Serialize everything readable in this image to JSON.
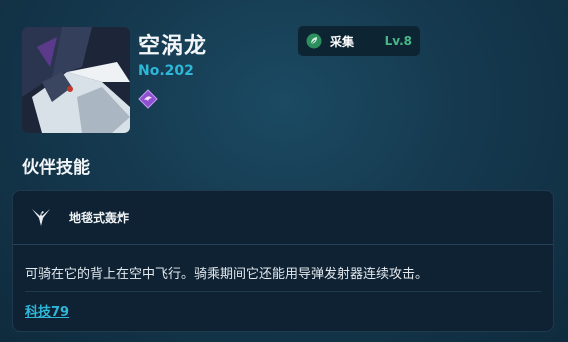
{
  "pal": {
    "name": "空涡龙",
    "number": "No.202",
    "element_icon": "dragon-element-icon",
    "work": {
      "icon": "leaf-icon",
      "label": "采集",
      "level": "Lv.8",
      "level_color": "#48b887"
    }
  },
  "partner_skill": {
    "section_title": "伙伴技能",
    "icon": "bird-icon",
    "name": "地毯式轰炸",
    "description": "可骑在它的背上在空中飞行。骑乘期间它还能用导弹发射器连续攻击。",
    "tech_link": "科技79"
  },
  "colors": {
    "accent": "#2fb7d8",
    "background": "#15394f",
    "card": "#0f2233"
  }
}
